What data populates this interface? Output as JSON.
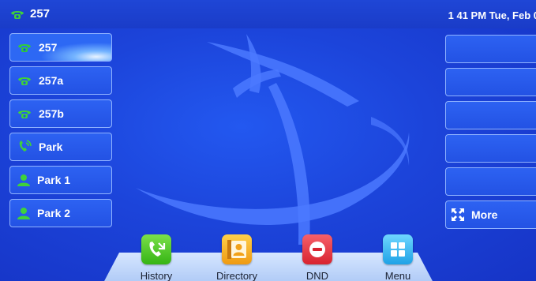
{
  "statusbar": {
    "account": "257",
    "datetime": "1 41 PM Tue, Feb 0"
  },
  "line_keys": [
    {
      "label": "257",
      "icon": "phone-icon",
      "active": true
    },
    {
      "label": "257a",
      "icon": "phone-icon",
      "active": false
    },
    {
      "label": "257b",
      "icon": "phone-icon",
      "active": false
    },
    {
      "label": "Park",
      "icon": "park-icon",
      "active": false
    },
    {
      "label": "Park 1",
      "icon": "contact-icon",
      "active": false
    },
    {
      "label": "Park 2",
      "icon": "contact-icon",
      "active": false
    }
  ],
  "right_keys": [
    {
      "label": ""
    },
    {
      "label": ""
    },
    {
      "label": ""
    },
    {
      "label": ""
    },
    {
      "label": ""
    },
    {
      "label": "More",
      "icon": "expand-icon"
    }
  ],
  "dock": [
    {
      "label": "History",
      "icon": "history-icon",
      "color": "#49c21e"
    },
    {
      "label": "Directory",
      "icon": "directory-icon",
      "color": "#f2a21a"
    },
    {
      "label": "DND",
      "icon": "dnd-icon",
      "color": "#e8343f"
    },
    {
      "label": "Menu",
      "icon": "menu-icon",
      "color": "#2fb6f0"
    }
  ],
  "colors": {
    "background": "#1c44da",
    "phone_icon": "#3fd23a"
  }
}
